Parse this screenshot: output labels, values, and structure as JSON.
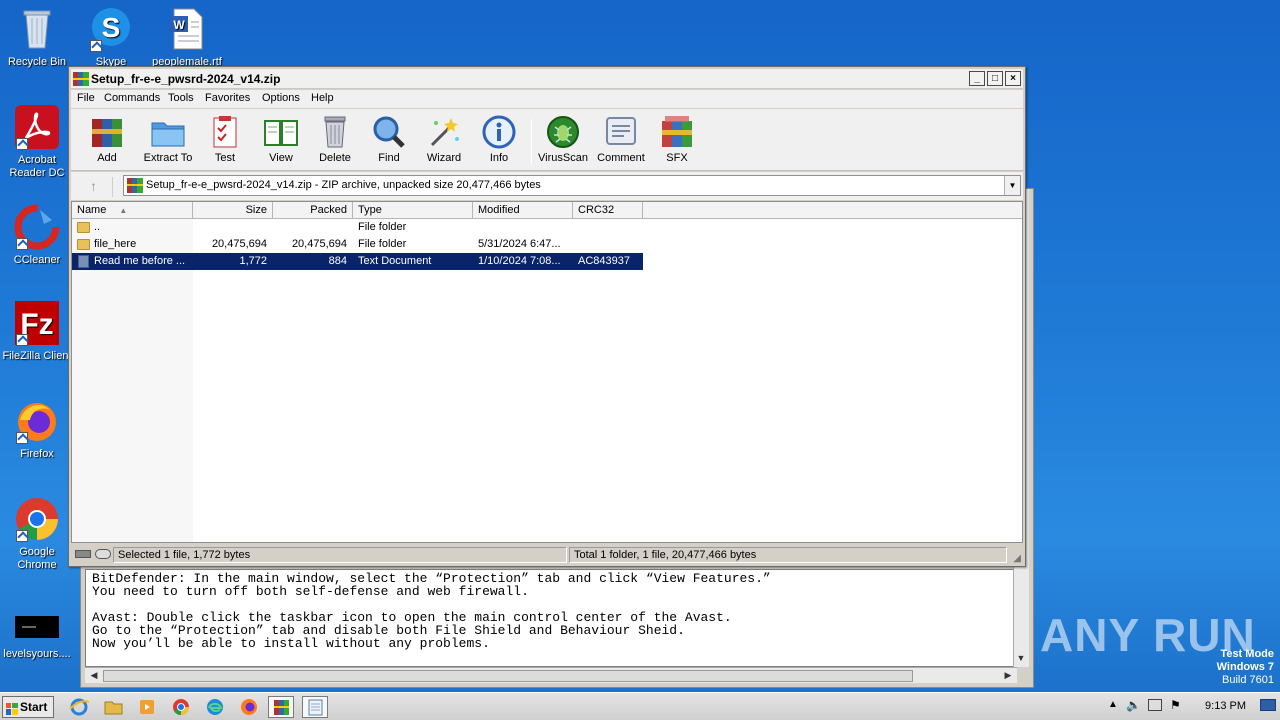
{
  "desktop": {
    "icons": [
      {
        "label": "Recycle Bin"
      },
      {
        "label": "Skype"
      },
      {
        "label": "peoplemale.rtf"
      },
      {
        "label": "Acrobat Reader DC"
      },
      {
        "label": "CCleaner"
      },
      {
        "label": "FileZilla Client"
      },
      {
        "label": "Firefox"
      },
      {
        "label": "Google Chrome"
      },
      {
        "label": "levelsyours...."
      }
    ]
  },
  "notepad": {
    "lines": "BitDefender: In the main window, select the “Protection” tab and click “View Features.”\nYou need to turn off both self-defense and web firewall.\n\nAvast: Double click the taskbar icon to open the main control center of the Avast.\nGo to the “Protection” tab and disable both File Shield and Behaviour Sheid.\nNow you’ll be able to install without any problems."
  },
  "winrar": {
    "title": "Setup_fr-e-e_pwsrd-2024_v14.zip",
    "menu": [
      "File",
      "Commands",
      "Tools",
      "Favorites",
      "Options",
      "Help"
    ],
    "toolbar": [
      "Add",
      "Extract To",
      "Test",
      "View",
      "Delete",
      "Find",
      "Wizard",
      "Info",
      "VirusScan",
      "Comment",
      "SFX"
    ],
    "address": "Setup_fr-e-e_pwsrd-2024_v14.zip - ZIP archive, unpacked size 20,477,466 bytes",
    "columns": [
      "Name",
      "Size",
      "Packed",
      "Type",
      "Modified",
      "CRC32"
    ],
    "rows": [
      {
        "name": "..",
        "size": "",
        "packed": "",
        "type": "File folder",
        "modified": "",
        "crc": ""
      },
      {
        "name": "file_here",
        "size": "20,475,694",
        "packed": "20,475,694",
        "type": "File folder",
        "modified": "5/31/2024 6:47...",
        "crc": ""
      },
      {
        "name": "Read me before ...",
        "size": "1,772",
        "packed": "884",
        "type": "Text Document",
        "modified": "1/10/2024 7:08...",
        "crc": "AC843937"
      }
    ],
    "status_left": "Selected 1 file, 1,772 bytes",
    "status_right": "Total 1 folder, 1 file, 20,477,466 bytes"
  },
  "watermark": "ANY RUN",
  "testmode": {
    "line1": "Test Mode",
    "line2": "Windows 7",
    "line3": "Build 7601"
  },
  "taskbar": {
    "start_label": "Start",
    "clock": "9:13 PM"
  }
}
